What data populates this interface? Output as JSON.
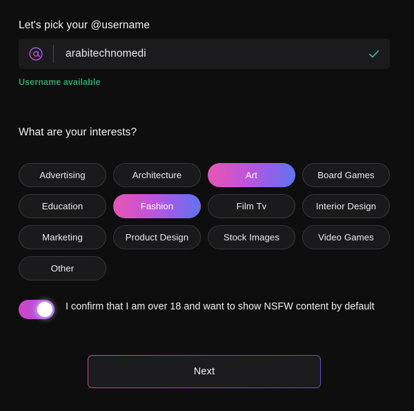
{
  "username_section": {
    "heading": "Let's pick your @username",
    "at_icon": "at-icon",
    "input_value": "arabitechnomedi",
    "input_placeholder": "username",
    "valid_icon": "check-icon",
    "status_text": "Username available",
    "status_color": "#2f9e68"
  },
  "interests_section": {
    "heading": "What are your interests?",
    "chips": [
      {
        "label": "Advertising",
        "selected": false
      },
      {
        "label": "Architecture",
        "selected": false
      },
      {
        "label": "Art",
        "selected": true
      },
      {
        "label": "Board Games",
        "selected": false
      },
      {
        "label": "Education",
        "selected": false
      },
      {
        "label": "Fashion",
        "selected": true
      },
      {
        "label": "Film Tv",
        "selected": false
      },
      {
        "label": "Interior Design",
        "selected": false
      },
      {
        "label": "Marketing",
        "selected": false
      },
      {
        "label": "Product Design",
        "selected": false
      },
      {
        "label": "Stock Images",
        "selected": false
      },
      {
        "label": "Video Games",
        "selected": false
      },
      {
        "label": "Other",
        "selected": false
      }
    ],
    "selected_gradient_start": "#e855b4",
    "selected_gradient_end": "#5f73f0"
  },
  "nsfw_section": {
    "toggle_state": "on",
    "toggle_gradient_start": "#d148c0",
    "toggle_gradient_end": "#9a52ef",
    "label": "I confirm that I am over 18 and want to show NSFW content by default"
  },
  "footer": {
    "next_label": "Next",
    "next_border_gradient_start": "#cf4a83",
    "next_border_gradient_end": "#5358c9"
  },
  "theme": {
    "background": "#0e0e0f",
    "surface": "#1b1b1d",
    "text_primary": "#f2f2f3"
  }
}
